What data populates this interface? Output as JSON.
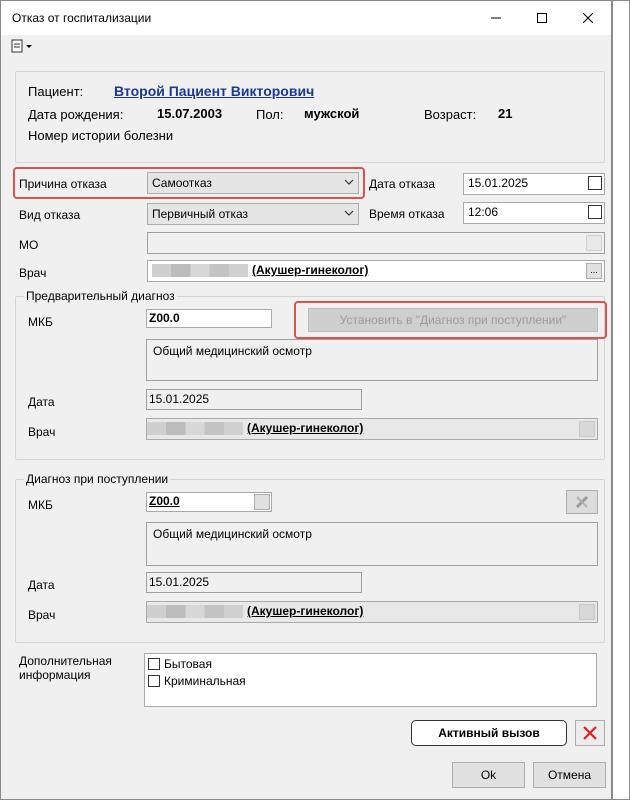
{
  "window": {
    "title": "Отказ от госпитализации"
  },
  "patient": {
    "label": "Пациент:",
    "name": "Второй Пациент Викторович",
    "dob_label": "Дата рождения:",
    "dob": "15.07.2003",
    "sex_label": "Пол:",
    "sex": "мужской",
    "age_label": "Возраст:",
    "age": "21",
    "history_label": "Номер истории болезни"
  },
  "refusal": {
    "reason_label": "Причина отказа",
    "reason_value": "Самоотказ",
    "date_label": "Дата отказа",
    "date_value": "15.01.2025",
    "type_label": "Вид отказа",
    "type_value": "Первичный отказ",
    "time_label": "Время отказа",
    "time_value": "12:06",
    "mo_label": "МО",
    "doctor_label": "Врач",
    "doctor_specialty": "(Акушер-гинеколог)"
  },
  "prelim": {
    "title": "Предварительный диагноз",
    "mkb_label": "МКБ",
    "mkb_value": "Z00.0",
    "set_button": "Установить в \"Диагноз при поступлении\"",
    "diagnosis_text": "Общий медицинский осмотр",
    "date_label": "Дата",
    "date_value": "15.01.2025",
    "doctor_label": "Врач",
    "doctor_specialty": "(Акушер-гинеколог)"
  },
  "admission": {
    "title": "Диагноз при поступлении",
    "mkb_label": "МКБ",
    "mkb_value": "Z00.0",
    "diagnosis_text": "Общий медицинский осмотр",
    "date_label": "Дата",
    "date_value": "15.01.2025",
    "doctor_label": "Врач",
    "doctor_specialty": "(Акушер-гинеколог)"
  },
  "extra": {
    "label": "Дополнительная информация",
    "options": [
      "Бытовая",
      "Криминальная"
    ]
  },
  "buttons": {
    "active_call": "Активный вызов",
    "ok": "Ok",
    "cancel": "Отмена"
  },
  "colors": {
    "link": "#1a3a8f",
    "highlight": "#d9534f"
  }
}
